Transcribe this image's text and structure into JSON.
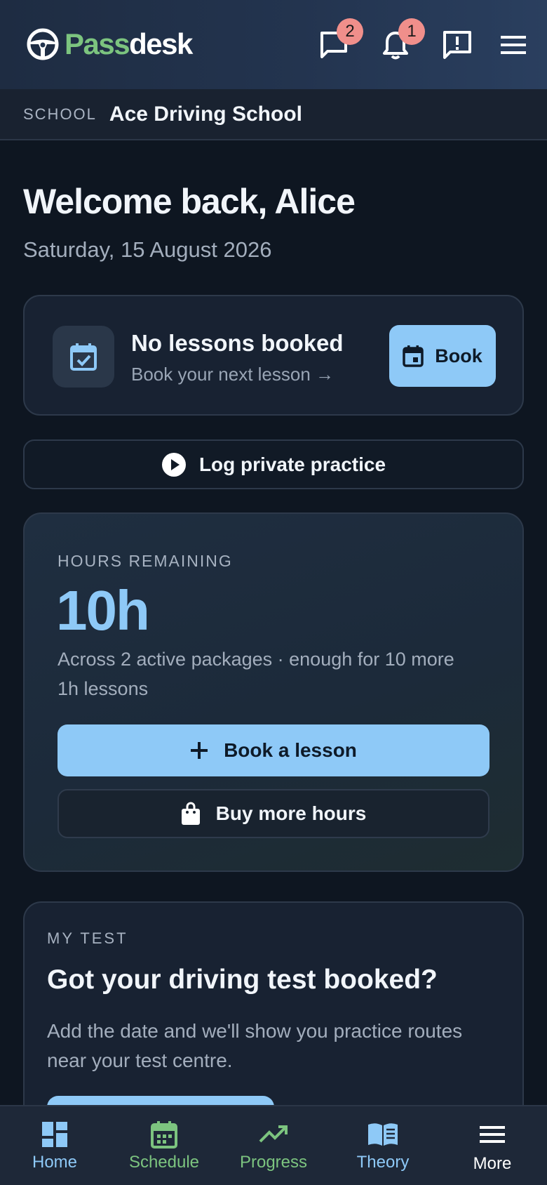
{
  "header": {
    "brand_part1": "Pass",
    "brand_part2": "desk",
    "messages_badge": "2",
    "notifications_badge": "1"
  },
  "school": {
    "label": "SCHOOL",
    "name": "Ace Driving School"
  },
  "welcome": {
    "title": "Welcome back, Alice",
    "date": "Saturday, 15 August 2026"
  },
  "next_lesson": {
    "title": "No lessons booked",
    "subtitle": "Book your next lesson →",
    "book_label": "Book"
  },
  "practice": {
    "label": "Log private practice"
  },
  "hours": {
    "label": "HOURS REMAINING",
    "value": "10h",
    "description": "Across 2 active packages · enough for 10 more 1h lessons",
    "book_label": "Book a lesson",
    "buy_label": "Buy more hours"
  },
  "test": {
    "label": "MY TEST",
    "title": "Got your driving test booked?",
    "description": "Add the date and we'll show you practice routes near your test centre."
  },
  "nav": {
    "items": [
      {
        "label": "Home",
        "icon": "dashboard-icon",
        "color": "#8ec9f7"
      },
      {
        "label": "Schedule",
        "icon": "calendar-icon",
        "color": "#7cc47f"
      },
      {
        "label": "Progress",
        "icon": "trending-up-icon",
        "color": "#7cc47f"
      },
      {
        "label": "Theory",
        "icon": "book-icon",
        "color": "#8ec9f7"
      },
      {
        "label": "More",
        "icon": "menu-icon",
        "color": "#ffffff"
      }
    ]
  },
  "colors": {
    "accent_blue": "#8ec9f7",
    "accent_green": "#7cc47f",
    "badge": "#f08f8b",
    "background": "#0e1621"
  }
}
